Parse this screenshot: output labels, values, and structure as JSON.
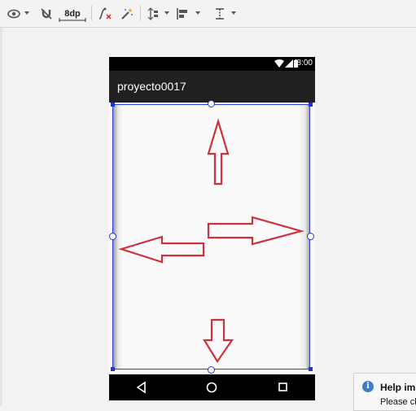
{
  "toolbar": {
    "margin_label": "8dp",
    "icons": [
      "eye-icon",
      "magnet-off-icon",
      "margin-icon",
      "clear-constraints-icon",
      "magic-wand-icon",
      "pack-icon",
      "align-icon",
      "guidelines-icon"
    ]
  },
  "device": {
    "status_time": "8:00",
    "app_title": "proyecto0017",
    "nav_buttons": [
      "back",
      "home",
      "recents"
    ]
  },
  "notification": {
    "title": "Help imp",
    "body": "Please cl"
  },
  "colors": {
    "arrow_stroke": "#d0303a",
    "selection": "#2233cc",
    "app_bar": "#212121"
  }
}
